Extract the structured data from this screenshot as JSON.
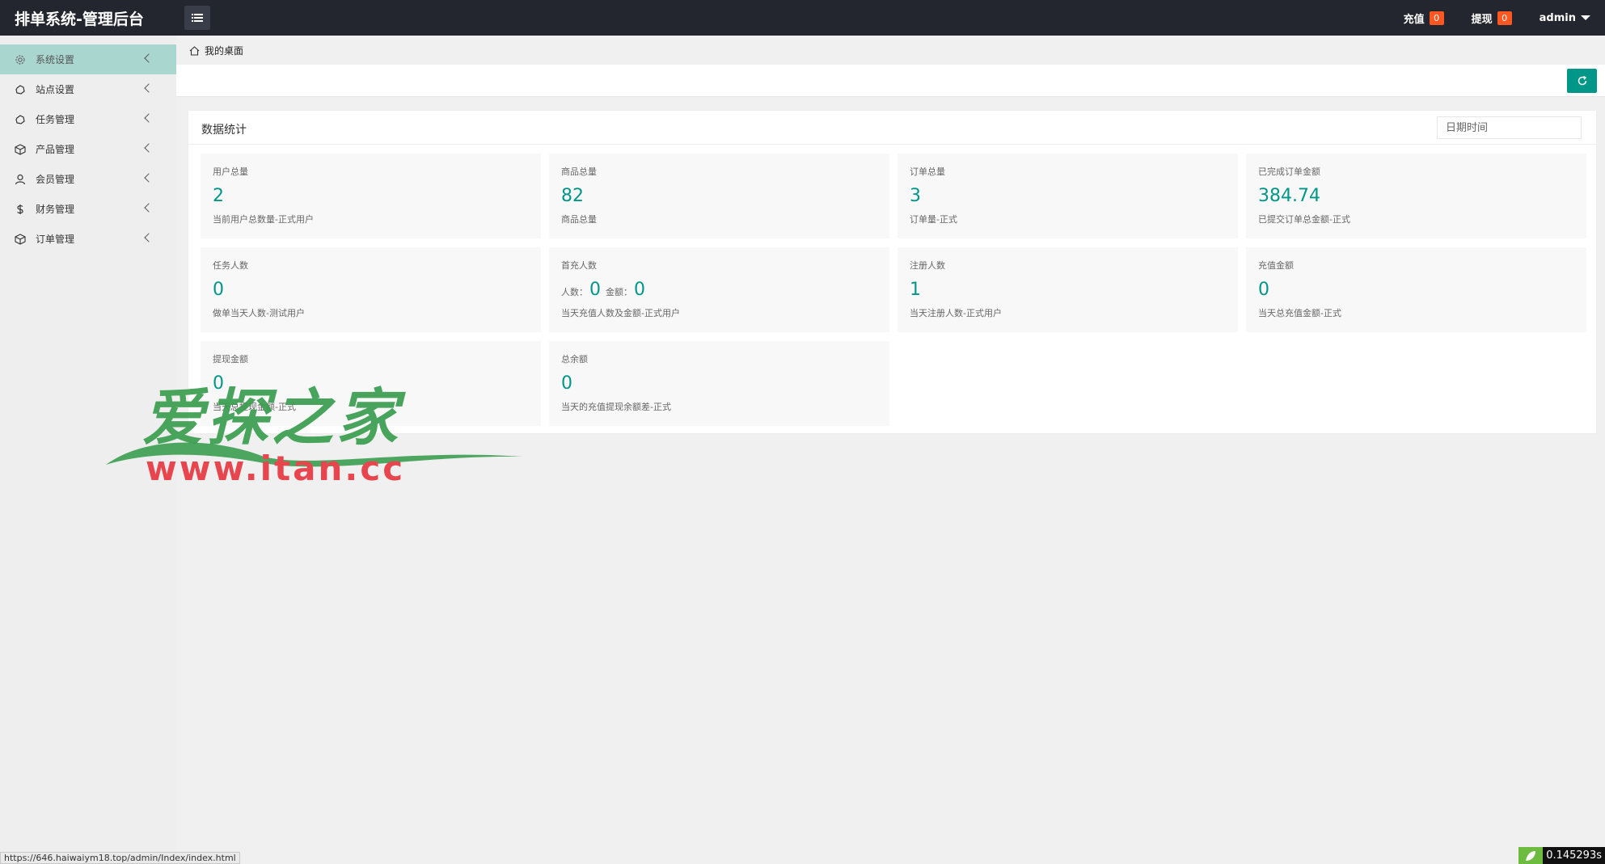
{
  "app": {
    "title": "排单系统-管理后台"
  },
  "header": {
    "recharge_label": "充值",
    "recharge_count": "0",
    "withdraw_label": "提现",
    "withdraw_count": "0",
    "user_label": "admin"
  },
  "sidebar": {
    "items": [
      {
        "label": "系统设置",
        "icon": "gear-icon"
      },
      {
        "label": "站点设置",
        "icon": "globe-icon"
      },
      {
        "label": "任务管理",
        "icon": "globe-icon"
      },
      {
        "label": "产品管理",
        "icon": "box-icon"
      },
      {
        "label": "会员管理",
        "icon": "user-icon"
      },
      {
        "label": "财务管理",
        "icon": "dollar-icon"
      },
      {
        "label": "订单管理",
        "icon": "box-icon"
      }
    ]
  },
  "breadcrumb": {
    "home": "我的桌面"
  },
  "panel": {
    "title": "数据统计",
    "date_placeholder": "日期时间"
  },
  "cards": [
    {
      "title": "用户总量",
      "value": "2",
      "desc": "当前用户总数量-正式用户"
    },
    {
      "title": "商品总量",
      "value": "82",
      "desc": "商品总量"
    },
    {
      "title": "订单总量",
      "value": "3",
      "desc": "订单量-正式"
    },
    {
      "title": "已完成订单金额",
      "value": "384.74",
      "desc": "已提交订单总金额-正式"
    },
    {
      "title": "任务人数",
      "value": "0",
      "desc": "做单当天人数-测试用户"
    },
    {
      "title": "首充人数",
      "people_label": "人数：",
      "people_value": "0",
      "amount_label": "金额：",
      "amount_value": "0",
      "desc": "当天充值人数及金额-正式用户"
    },
    {
      "title": "注册人数",
      "value": "1",
      "desc": "当天注册人数-正式用户"
    },
    {
      "title": "充值金额",
      "value": "0",
      "desc": "当天总充值金额-正式"
    },
    {
      "title": "提现金额",
      "value": "0",
      "desc": "当天总提现金额-正式"
    },
    {
      "title": "总余额",
      "value": "0",
      "desc": "当天的充值提现余额差-正式"
    }
  ],
  "watermark": {
    "cn": "爱探之家",
    "en": "www.itan.cc"
  },
  "statusbar": {
    "url": "https://646.haiwaiym18.top/admin/Index/index.html"
  },
  "timer": {
    "text": "0.145293s"
  },
  "colors": {
    "header_bg": "#23262e",
    "accent": "#009688",
    "badge": "#ff5722",
    "sidebar_active": "#a9d7d0"
  }
}
